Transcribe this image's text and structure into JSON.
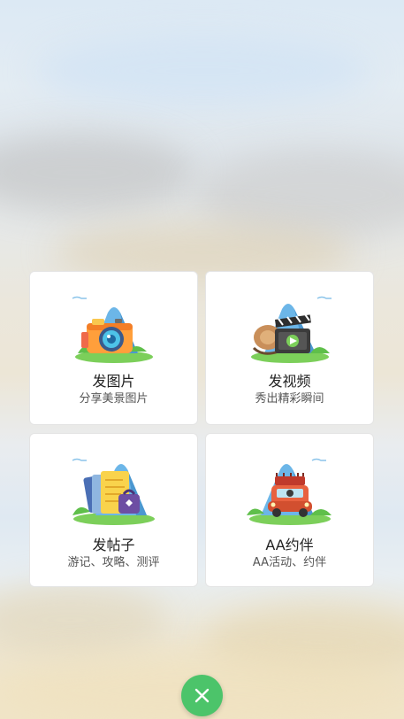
{
  "cards": [
    {
      "title": "发图片",
      "subtitle": "分享美景图片",
      "icon": "camera-icon"
    },
    {
      "title": "发视频",
      "subtitle": "秀出精彩瞬间",
      "icon": "video-clapper-icon"
    },
    {
      "title": "发帖子",
      "subtitle": "游记、攻略、测评",
      "icon": "documents-icon"
    },
    {
      "title": "AA约伴",
      "subtitle": "AA活动、约伴",
      "icon": "travel-car-icon"
    }
  ],
  "close_button": {
    "icon": "close-icon"
  },
  "colors": {
    "accent_green": "#4cc46a",
    "card_bg": "#ffffff",
    "mountain_blue": "#6cb6e8",
    "grass_green": "#7ccf5a"
  }
}
